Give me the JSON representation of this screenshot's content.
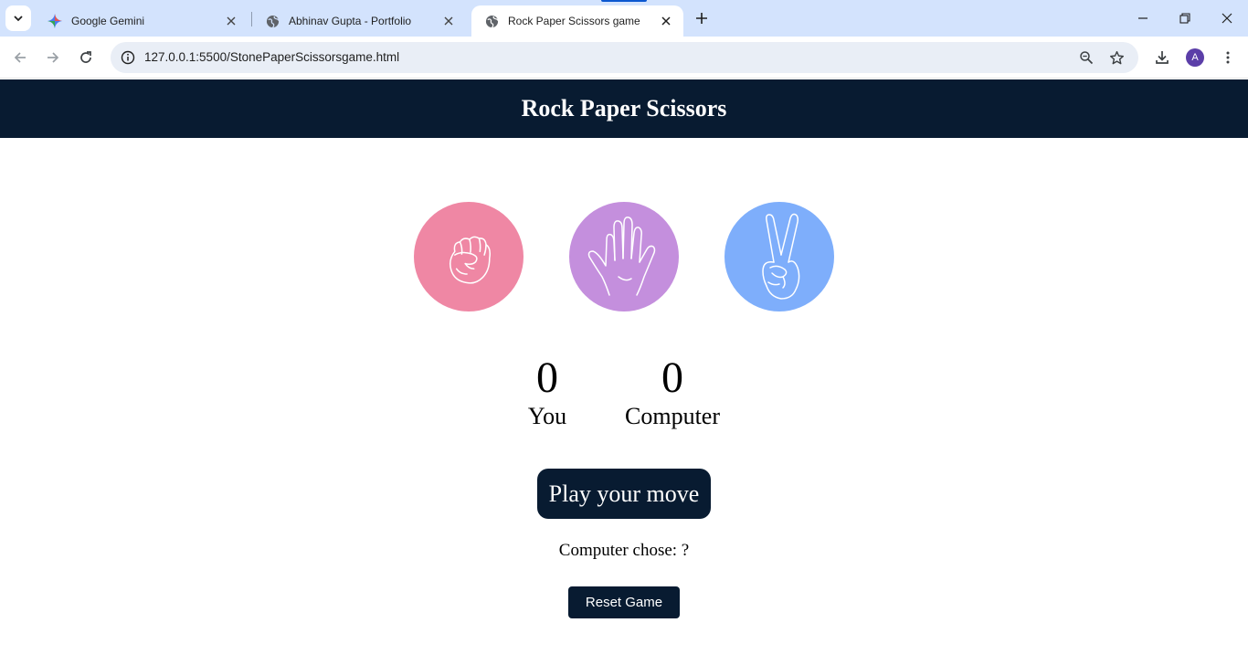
{
  "browser": {
    "tabs": [
      {
        "title": "Google Gemini",
        "icon": "gemini-icon",
        "active": false
      },
      {
        "title": "Abhinav Gupta - Portfolio",
        "icon": "globe-icon",
        "active": false
      },
      {
        "title": "Rock Paper Scissors game",
        "icon": "globe-icon",
        "active": true
      }
    ],
    "url": "127.0.0.1:5500/StonePaperScissorsgame.html",
    "profile_initial": "A",
    "colors": {
      "tabstrip": "#d3e3fd",
      "omnibox": "#e9eef6",
      "avatar": "#5b3ea8"
    }
  },
  "page": {
    "title": "Rock Paper Scissors",
    "choices": [
      {
        "name": "rock",
        "icon": "fist-icon",
        "color": "#ef87a4"
      },
      {
        "name": "paper",
        "icon": "open-hand-icon",
        "color": "#c48fdd"
      },
      {
        "name": "scissors",
        "icon": "peace-hand-icon",
        "color": "#7eaefb"
      }
    ],
    "scores": {
      "user": {
        "value": "0",
        "label": "You"
      },
      "computer": {
        "value": "0",
        "label": "Computer"
      }
    },
    "play_button": "Play your move",
    "computer_chose": "Computer chose: ?",
    "reset_button": "Reset Game",
    "colors": {
      "header_bg": "#081b31",
      "button_bg": "#081b31"
    }
  }
}
